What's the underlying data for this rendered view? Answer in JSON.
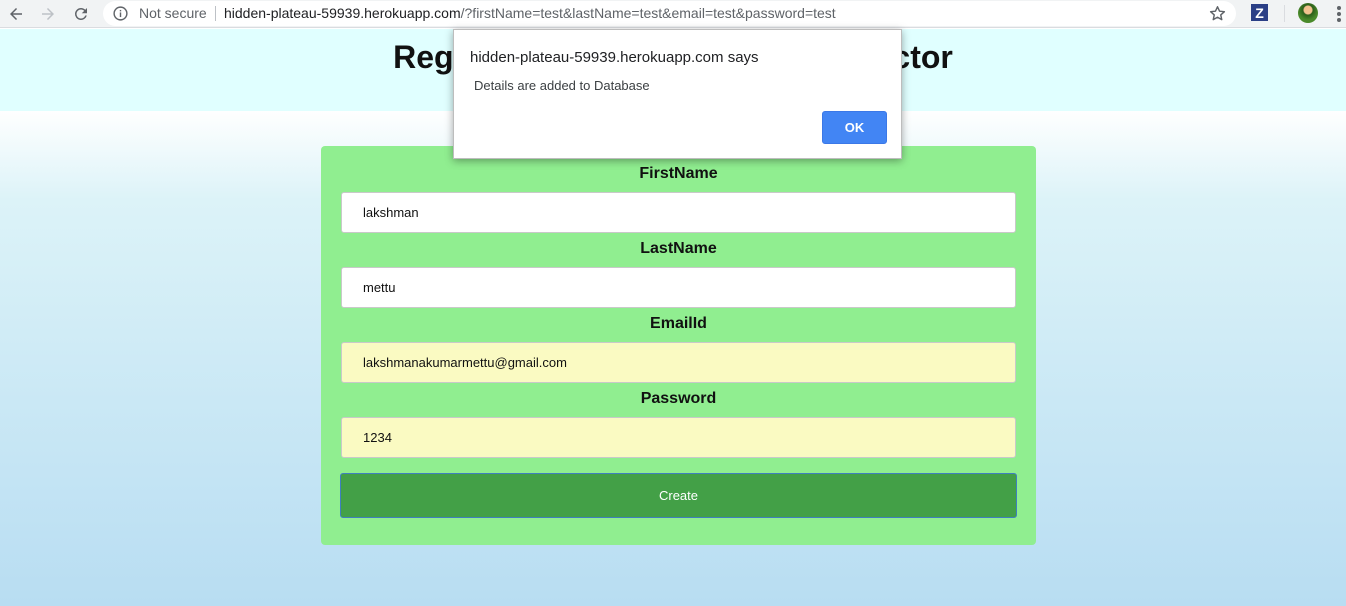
{
  "browser": {
    "security_label": "Not secure",
    "url_host": "hidden-plateau-59939.herokuapp.com",
    "url_path": "/?firstName=test&lastName=test&email=test&password=test",
    "extension_label": "Z",
    "icons": [
      "back-arrow-icon",
      "forward-arrow-icon",
      "reload-icon",
      "info-icon",
      "star-icon",
      "extension-z-icon",
      "profile-avatar",
      "menu-dots-icon"
    ]
  },
  "page": {
    "title_left": "Reg",
    "title_right": "ector",
    "header_color": "#e0ffff"
  },
  "form": {
    "background": "#90ee90",
    "fields": [
      {
        "label": "FirstName",
        "value": "lakshman"
      },
      {
        "label": "LastName",
        "value": "mettu"
      },
      {
        "label": "EmailId",
        "value": "lakshmanakumarmettu@gmail.com"
      },
      {
        "label": "Password",
        "value": "1234"
      }
    ],
    "submit_label": "Create",
    "submit_color": "#43a047"
  },
  "alert": {
    "title": "hidden-plateau-59939.herokuapp.com says",
    "message": "Details are added to Database",
    "ok_label": "OK",
    "ok_color": "#4285f4"
  }
}
